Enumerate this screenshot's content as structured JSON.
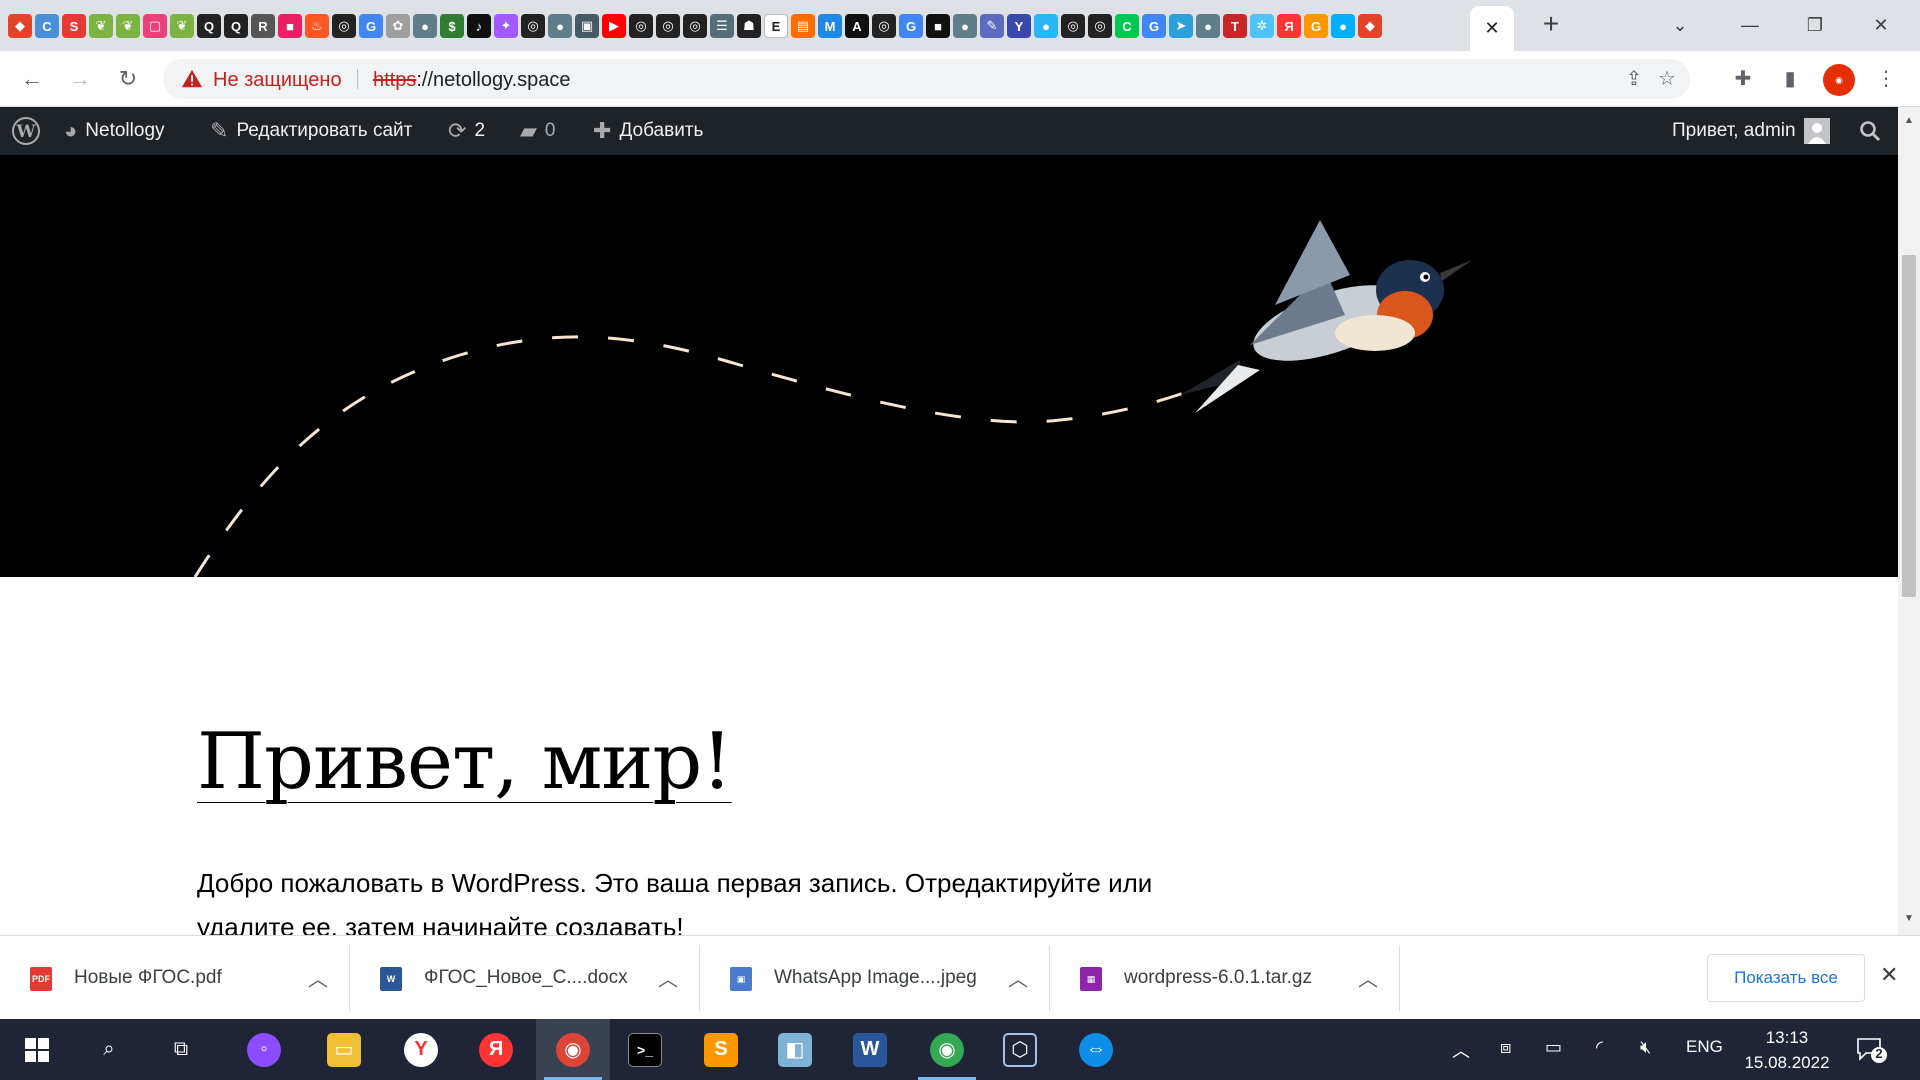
{
  "browser": {
    "tab_favicons": [
      {
        "name": "gitlab-icon",
        "color": "#e24329",
        "glyph": "◆"
      },
      {
        "name": "cru-icon",
        "color": "#4a90d9",
        "glyph": "C"
      },
      {
        "name": "s-icon",
        "color": "#e53935",
        "glyph": "S"
      },
      {
        "name": "leaf-icon",
        "color": "#7cb342",
        "glyph": "❦"
      },
      {
        "name": "leaf-icon",
        "color": "#7cb342",
        "glyph": "❦"
      },
      {
        "name": "pink-icon",
        "color": "#ec407a",
        "glyph": "▢"
      },
      {
        "name": "leaf-icon",
        "color": "#7cb342",
        "glyph": "❦"
      },
      {
        "name": "search-icon",
        "color": "#222",
        "glyph": "Q"
      },
      {
        "name": "search-icon",
        "color": "#222",
        "glyph": "Q"
      },
      {
        "name": "r-icon",
        "color": "#555",
        "glyph": "R"
      },
      {
        "name": "pink-square-icon",
        "color": "#e91e63",
        "glyph": "■"
      },
      {
        "name": "fire-icon",
        "color": "#ff5722",
        "glyph": "♨"
      },
      {
        "name": "github-icon",
        "color": "#222",
        "glyph": "◎"
      },
      {
        "name": "google-icon",
        "color": "#4285f4",
        "glyph": "G"
      },
      {
        "name": "flower-icon",
        "color": "#9e9e9e",
        "glyph": "✿"
      },
      {
        "name": "globe-icon",
        "color": "#607d8b",
        "glyph": "●"
      },
      {
        "name": "money-icon",
        "color": "#2e7d32",
        "glyph": "$"
      },
      {
        "name": "tiktok-icon",
        "color": "#111",
        "glyph": "♪"
      },
      {
        "name": "figma-icon",
        "color": "#a259ff",
        "glyph": "✦"
      },
      {
        "name": "github-icon",
        "color": "#222",
        "glyph": "◎"
      },
      {
        "name": "globe-icon",
        "color": "#607d8b",
        "glyph": "●"
      },
      {
        "name": "box-icon",
        "color": "#455a64",
        "glyph": "▣"
      },
      {
        "name": "youtube-icon",
        "color": "#ff0000",
        "glyph": "▶"
      },
      {
        "name": "github-icon",
        "color": "#222",
        "glyph": "◎"
      },
      {
        "name": "github-icon",
        "color": "#222",
        "glyph": "◎"
      },
      {
        "name": "github-icon",
        "color": "#222",
        "glyph": "◎"
      },
      {
        "name": "doc-icon",
        "color": "#546e7a",
        "glyph": "☰"
      },
      {
        "name": "ghost-icon",
        "color": "#222",
        "glyph": "☗"
      },
      {
        "name": "e-icon",
        "color": "#fff",
        "glyph": "E"
      },
      {
        "name": "orange-icon",
        "color": "#ff6d00",
        "glyph": "▤"
      },
      {
        "name": "mail-icon",
        "color": "#1e88e5",
        "glyph": "M"
      },
      {
        "name": "a-icon",
        "color": "#111",
        "glyph": "A"
      },
      {
        "name": "github-icon",
        "color": "#222",
        "glyph": "◎"
      },
      {
        "name": "google-icon",
        "color": "#4285f4",
        "glyph": "G"
      },
      {
        "name": "camera-icon",
        "color": "#111",
        "glyph": "■"
      },
      {
        "name": "globe-icon",
        "color": "#607d8b",
        "glyph": "●"
      },
      {
        "name": "tool-icon",
        "color": "#5c6bc0",
        "glyph": "✎"
      },
      {
        "name": "y-icon",
        "color": "#3949ab",
        "glyph": "Y"
      },
      {
        "name": "circle-icon",
        "color": "#29b6f6",
        "glyph": "●"
      },
      {
        "name": "github-icon",
        "color": "#222",
        "glyph": "◎"
      },
      {
        "name": "github-icon",
        "color": "#222",
        "glyph": "◎"
      },
      {
        "name": "c-icon",
        "color": "#00c853",
        "glyph": "C"
      },
      {
        "name": "google-icon",
        "color": "#4285f4",
        "glyph": "G"
      },
      {
        "name": "telegram-icon",
        "color": "#2aa1da",
        "glyph": "➤"
      },
      {
        "name": "globe-icon",
        "color": "#607d8b",
        "glyph": "●"
      },
      {
        "name": "t-icon",
        "color": "#c62828",
        "glyph": "T"
      },
      {
        "name": "gear-icon",
        "color": "#4fc3f7",
        "glyph": "✲"
      },
      {
        "name": "yandex-icon",
        "color": "#ff3333",
        "glyph": "Я"
      },
      {
        "name": "google-icon",
        "color": "#ff9800",
        "glyph": "G"
      },
      {
        "name": "drop-icon",
        "color": "#00b0ff",
        "glyph": "●"
      },
      {
        "name": "gitlab-icon",
        "color": "#e24329",
        "glyph": "◆"
      }
    ],
    "active_tab_close": "✕",
    "new_tab": "+",
    "security_label": "Не защищено",
    "url_scheme": "https",
    "url_rest": "://netollogy.space"
  },
  "wpbar": {
    "site_name": "Netollogy",
    "edit_site": "Редактировать сайт",
    "updates_count": "2",
    "comments_count": "0",
    "add_new": "Добавить",
    "greeting": "Привет, admin"
  },
  "post": {
    "title": "Привет, мир!",
    "body": "Добро пожаловать в WordPress. Это ваша первая запись. Отредактируйте или удалите ее, затем начинайте создавать!"
  },
  "downloads": {
    "items": [
      {
        "name": "Новые ФГОС.pdf",
        "icon_color": "#e53935",
        "icon_label": "PDF"
      },
      {
        "name": "ФГОС_Новое_С....docx",
        "icon_color": "#2b579a",
        "icon_label": "W"
      },
      {
        "name": "WhatsApp Image....jpeg",
        "icon_color": "#4a7bd0",
        "icon_label": "▣"
      },
      {
        "name": "wordpress-6.0.1.tar.gz",
        "icon_color": "#8e24aa",
        "icon_label": "▦"
      }
    ],
    "show_all": "Показать все"
  },
  "taskbar": {
    "lang": "ENG",
    "time": "13:13",
    "date": "15.08.2022",
    "notifications": "2"
  },
  "colors": {
    "wp_admin_bar": "#1d2327",
    "hero_background": "#000000",
    "dash_line": "#f5e6d0",
    "link_blue": "#1a73e8"
  }
}
